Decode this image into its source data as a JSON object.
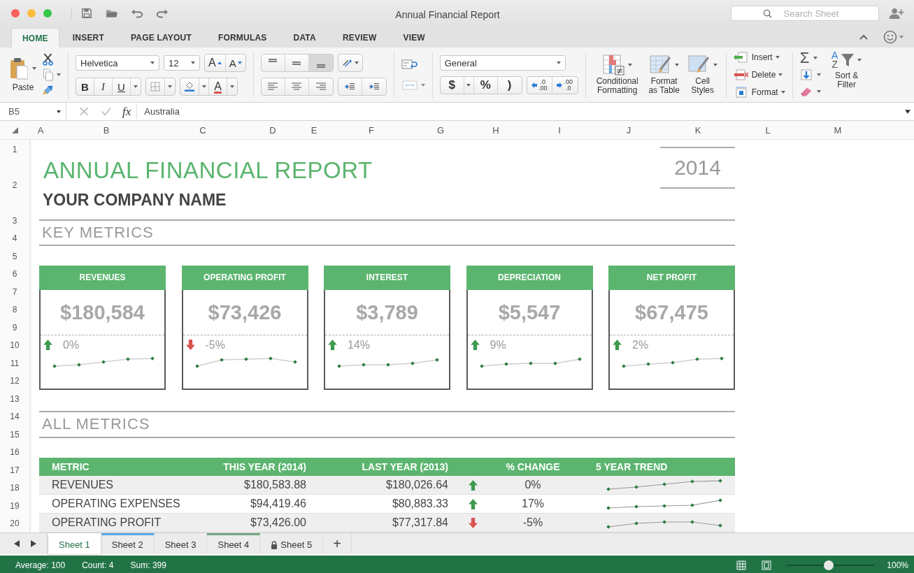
{
  "window": {
    "title": "Annual Financial Report"
  },
  "search": {
    "placeholder": "Search Sheet"
  },
  "ribbon_tabs": [
    {
      "label": "HOME",
      "selected": true
    },
    {
      "label": "INSERT",
      "selected": false
    },
    {
      "label": "PAGE LAYOUT",
      "selected": false
    },
    {
      "label": "FORMULAS",
      "selected": false
    },
    {
      "label": "DATA",
      "selected": false
    },
    {
      "label": "REVIEW",
      "selected": false
    },
    {
      "label": "VIEW",
      "selected": false
    }
  ],
  "ribbon": {
    "paste_label": "Paste",
    "font": {
      "family": "Helvetica",
      "size": "12",
      "grow": "A",
      "shrink": "A",
      "bold": "B",
      "italic": "I",
      "underline": "U",
      "font_color": "A"
    },
    "number": {
      "format": "General",
      "currency": "$",
      "percent": "%",
      "comma": ")",
      "increase_decimal": [
        ".0",
        ".00"
      ],
      "decrease_decimal": [
        ".00",
        ".0"
      ]
    },
    "styles": [
      {
        "label": "Conditional Formatting",
        "kind": "conditional"
      },
      {
        "label": "Format as Table",
        "kind": "table"
      },
      {
        "label": "Cell Styles",
        "kind": "cell"
      }
    ],
    "cells": [
      {
        "label": "Insert",
        "kind": "insert"
      },
      {
        "label": "Delete",
        "kind": "delete"
      },
      {
        "label": "Format",
        "kind": "format"
      }
    ],
    "autosum": "Σ",
    "sort": {
      "letters": [
        "A",
        "Z"
      ],
      "label": "Sort & Filter"
    }
  },
  "formula_bar": {
    "name_box": "B5",
    "fx": "fx",
    "value": "Australia"
  },
  "columns": [
    "A",
    "B",
    "C",
    "D",
    "E",
    "F",
    "G",
    "H",
    "I",
    "J",
    "K",
    "L",
    "M"
  ],
  "rows": [
    "1",
    "2",
    "3",
    "4",
    "5",
    "6",
    "7",
    "8",
    "9",
    "10",
    "11",
    "12",
    "13",
    "14",
    "15",
    "16",
    "17",
    "18",
    "19",
    "20"
  ],
  "report": {
    "title": "ANNUAL FINANCIAL REPORT",
    "company": "YOUR COMPANY NAME",
    "year": "2014",
    "key_metrics_heading": "KEY METRICS",
    "cards": [
      {
        "title": "REVENUES",
        "value": "$180,584",
        "change": "0%",
        "rising": true
      },
      {
        "title": "OPERATING PROFIT",
        "value": "$73,426",
        "change": "-5%",
        "rising": false
      },
      {
        "title": "INTEREST",
        "value": "$3,789",
        "change": "14%",
        "rising": true
      },
      {
        "title": "DEPRECIATION",
        "value": "$5,547",
        "change": "9%",
        "rising": true
      },
      {
        "title": "NET PROFIT",
        "value": "$67,475",
        "change": "2%",
        "rising": true
      }
    ],
    "all_metrics_heading": "ALL METRICS",
    "table": {
      "columns": [
        "METRIC",
        "THIS YEAR (2014)",
        "LAST YEAR (2013)",
        "% CHANGE",
        "5 YEAR TREND"
      ],
      "rows": [
        {
          "metric": "REVENUES",
          "this_year": "$180,583.88",
          "last_year": "$180,026.64",
          "rising": true,
          "change": "0%"
        },
        {
          "metric": "OPERATING EXPENSES",
          "this_year": "$94,419.46",
          "last_year": "$80,883.33",
          "rising": true,
          "change": "17%"
        },
        {
          "metric": "OPERATING PROFIT",
          "this_year": "$73,426.00",
          "last_year": "$77,317.84",
          "rising": false,
          "change": "-5%"
        }
      ]
    }
  },
  "sheet_tabs": [
    {
      "label": "Sheet 1",
      "selected": true,
      "locked": false
    },
    {
      "label": "Sheet 2",
      "selected": false,
      "locked": false,
      "color": "#5aa7e8"
    },
    {
      "label": "Sheet 3",
      "selected": false,
      "locked": false
    },
    {
      "label": "Sheet 4",
      "selected": false,
      "locked": false,
      "color": "#6fa87f"
    },
    {
      "label": "Sheet 5",
      "selected": false,
      "locked": true
    }
  ],
  "add_sheet": "+",
  "status_bar": {
    "items": [
      "Average: 100",
      "Count: 4",
      "Sum: 399"
    ],
    "zoom": {
      "level": 0.48,
      "reading": "100%"
    }
  }
}
